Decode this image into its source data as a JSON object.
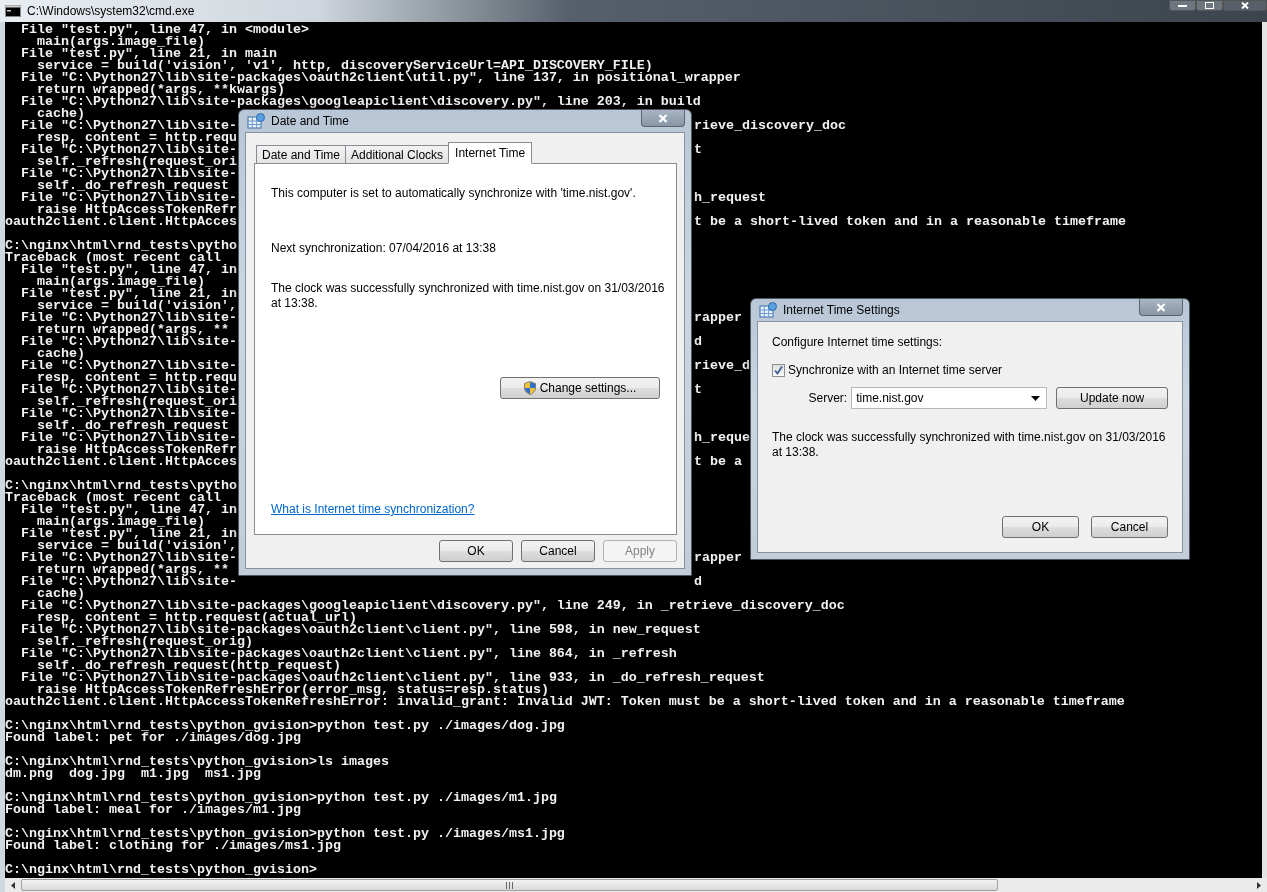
{
  "console": {
    "title": "C:\\Windows\\system32\\cmd.exe",
    "blocks": [
      [
        {
          "text": "  File \"test.py\", line 47, in <module>"
        },
        {
          "text": "    main(args.image_file)"
        },
        {
          "text": "  File \"test.py\", line 21, in main"
        },
        {
          "text": "    service = build('vision', 'v1', http, discoveryServiceUrl=API_DISCOVERY_FILE)"
        },
        {
          "text": "  File \"C:\\Python27\\lib\\site-packages\\oauth2client\\util.py\", line 137, in positional_wrapper"
        },
        {
          "text": "    return wrapped(*args, **kwargs)"
        },
        {
          "text": "  File \"C:\\Python27\\lib\\site-packages\\googleapiclient\\discovery.py\", line 203, in build"
        },
        {
          "text": "    cache)"
        },
        {
          "text": "  File \"C:\\Python27\\lib\\site-",
          "right": "rieve_discovery_doc"
        },
        {
          "text": "    resp, content = http.requ"
        },
        {
          "text": "  File \"C:\\Python27\\lib\\site-",
          "right": "t"
        },
        {
          "text": "    self._refresh(request_ori"
        },
        {
          "text": "  File \"C:\\Python27\\lib\\site-"
        },
        {
          "text": "    self._do_refresh_request"
        },
        {
          "text": "  File \"C:\\Python27\\lib\\site-",
          "right": "h_request"
        },
        {
          "text": "    raise HttpAccessTokenRefr"
        },
        {
          "text": "oauth2client.client.HttpAcces",
          "right": "t be a short-lived token and in a reasonable timeframe"
        }
      ],
      [
        {
          "text": "C:\\nginx\\html\\rnd_tests\\pytho"
        },
        {
          "text": "Traceback (most recent call"
        },
        {
          "text": "  File \"test.py\", line 47, in"
        },
        {
          "text": "    main(args.image_file)"
        },
        {
          "text": "  File \"test.py\", line 21, in"
        },
        {
          "text": "    service = build('vision',"
        },
        {
          "text": "  File \"C:\\Python27\\lib\\site-",
          "right": "rapper"
        },
        {
          "text": "    return wrapped(*args, **"
        },
        {
          "text": "  File \"C:\\Python27\\lib\\site-",
          "right": "d"
        },
        {
          "text": "    cache)"
        },
        {
          "text": "  File \"C:\\Python27\\lib\\site-",
          "right": "rieve_d"
        },
        {
          "text": "    resp, content = http.requ"
        },
        {
          "text": "  File \"C:\\Python27\\lib\\site-",
          "right": "t"
        },
        {
          "text": "    self._refresh(request_ori"
        },
        {
          "text": "  File \"C:\\Python27\\lib\\site-"
        },
        {
          "text": "    self._do_refresh_request"
        },
        {
          "text": "  File \"C:\\Python27\\lib\\site-",
          "right": "h_reque"
        },
        {
          "text": "    raise HttpAccessTokenRefr"
        },
        {
          "text": "oauth2client.client.HttpAcces",
          "right": "t be a"
        }
      ],
      [
        {
          "text": "C:\\nginx\\html\\rnd_tests\\pytho"
        },
        {
          "text": "Traceback (most recent call"
        },
        {
          "text": "  File \"test.py\", line 47, in"
        },
        {
          "text": "    main(args.image_file)"
        },
        {
          "text": "  File \"test.py\", line 21, in"
        },
        {
          "text": "    service = build('vision',"
        },
        {
          "text": "  File \"C:\\Python27\\lib\\site-",
          "right": "rapper"
        },
        {
          "text": "    return wrapped(*args, **"
        },
        {
          "text": "  File \"C:\\Python27\\lib\\site-",
          "right": "d"
        },
        {
          "text": "    cache)"
        },
        {
          "text": "  File \"C:\\Python27\\lib\\site-packages\\googleapiclient\\discovery.py\", line 249, in _retrieve_discovery_doc"
        },
        {
          "text": "    resp, content = http.request(actual_url)"
        },
        {
          "text": "  File \"C:\\Python27\\lib\\site-packages\\oauth2client\\client.py\", line 598, in new_request"
        },
        {
          "text": "    self._refresh(request_orig)"
        },
        {
          "text": "  File \"C:\\Python27\\lib\\site-packages\\oauth2client\\client.py\", line 864, in _refresh"
        },
        {
          "text": "    self._do_refresh_request(http_request)"
        },
        {
          "text": "  File \"C:\\Python27\\lib\\site-packages\\oauth2client\\client.py\", line 933, in _do_refresh_request"
        },
        {
          "text": "    raise HttpAccessTokenRefreshError(error_msg, status=resp.status)"
        },
        {
          "text": "oauth2client.client.HttpAccessTokenRefreshError: invalid_grant: Invalid JWT: Token must be a short-lived token and in a reasonable timeframe"
        }
      ],
      [
        {
          "text": "C:\\nginx\\html\\rnd_tests\\python_gvision>python test.py ./images/dog.jpg"
        },
        {
          "text": "Found label: pet for ./images/dog.jpg"
        }
      ],
      [
        {
          "text": "C:\\nginx\\html\\rnd_tests\\python_gvision>ls images"
        },
        {
          "text": "dm.png  dog.jpg  m1.jpg  ms1.jpg"
        }
      ],
      [
        {
          "text": "C:\\nginx\\html\\rnd_tests\\python_gvision>python test.py ./images/m1.jpg"
        },
        {
          "text": "Found label: meal for ./images/m1.jpg"
        }
      ],
      [
        {
          "text": "C:\\nginx\\html\\rnd_tests\\python_gvision>python test.py ./images/ms1.jpg"
        },
        {
          "text": "Found label: clothing for ./images/ms1.jpg"
        }
      ],
      [
        {
          "text": "C:\\nginx\\html\\rnd_tests\\python_gvision>"
        }
      ]
    ]
  },
  "date_time_dialog": {
    "title": "Date and Time",
    "tabs": [
      {
        "label": "Date and Time",
        "selected": false
      },
      {
        "label": "Additional Clocks",
        "selected": false
      },
      {
        "label": "Internet Time",
        "selected": true
      }
    ],
    "sync_text": "This computer is set to automatically synchronize with 'time.nist.gov'.",
    "next_sync": "Next synchronization: 07/04/2016 at 13:38",
    "last_sync": "The clock was successfully synchronized with time.nist.gov on 31/03/2016 at 13:38.",
    "change_button": "Change settings...",
    "help_link": "What is Internet time synchronization?",
    "buttons": [
      {
        "label": "OK",
        "disabled": false
      },
      {
        "label": "Cancel",
        "disabled": false
      },
      {
        "label": "Apply",
        "disabled": true
      }
    ]
  },
  "internet_time_dialog": {
    "title": "Internet Time Settings",
    "heading": "Configure Internet time settings:",
    "sync_checkbox": {
      "label": "Synchronize with an Internet time server",
      "checked": true
    },
    "server_label": "Server:",
    "server_value": "time.nist.gov",
    "update_button": "Update now",
    "status_text": "The clock was successfully synchronized with time.nist.gov on 31/03/2016 at 13:38.",
    "buttons": [
      {
        "label": "OK",
        "disabled": false
      },
      {
        "label": "Cancel",
        "disabled": false
      }
    ]
  }
}
